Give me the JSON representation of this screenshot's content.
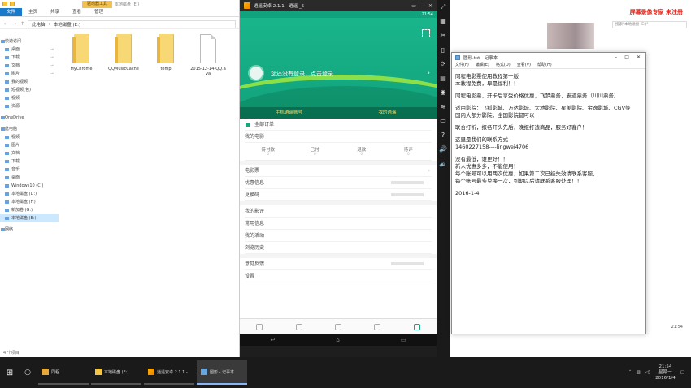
{
  "explorer": {
    "context_tab": "驱动器工具",
    "title": "本地磁盘 (E:)",
    "ribbon_tabs": [
      "文件",
      "主页",
      "共享",
      "查看",
      "管理"
    ],
    "address": [
      "此电脑",
      "本地磁盘 (E:)"
    ],
    "nav": [
      {
        "label": "快速访问",
        "section": true
      },
      {
        "label": "桌面",
        "pinned": true
      },
      {
        "label": "下载",
        "pinned": true
      },
      {
        "label": "文档",
        "pinned": true
      },
      {
        "label": "图片",
        "pinned": true
      },
      {
        "label": "我的视频"
      },
      {
        "label": "短视频(包)"
      },
      {
        "label": "视频"
      },
      {
        "label": "资源"
      },
      {
        "label": "OneDrive",
        "section": true
      },
      {
        "label": "此电脑",
        "section": true
      },
      {
        "label": "视频"
      },
      {
        "label": "图片"
      },
      {
        "label": "文档"
      },
      {
        "label": "下载"
      },
      {
        "label": "音乐"
      },
      {
        "label": "桌面"
      },
      {
        "label": "Windows10 (C:)"
      },
      {
        "label": "本地磁盘 (D:)"
      },
      {
        "label": "本地磁盘 (F:)"
      },
      {
        "label": "新加卷 (G:)"
      },
      {
        "label": "本地磁盘 (E:)",
        "selected": true
      },
      {
        "label": "网络",
        "section": true
      }
    ],
    "files": [
      {
        "name": "MyChrome",
        "kind": "folder"
      },
      {
        "name": "QQMusicCache",
        "kind": "folder"
      },
      {
        "name": "temp",
        "kind": "folder"
      },
      {
        "name": "2015-12-14-QQ.ava",
        "kind": "file"
      }
    ],
    "status": "4 个项目"
  },
  "emulator": {
    "title": "逍遥安卓 2.1.1 - 逍遥 _5",
    "clock": "21:54",
    "login_text": "您还没有登录，点击登录",
    "hero_links": [
      "手机逍遥账号",
      "我的逍遥"
    ],
    "menu_all_orders": "全部订单",
    "my_movies": "我的电影",
    "order_tabs": [
      {
        "label": "待付款",
        "count": "0"
      },
      {
        "label": "已付",
        "count": "0"
      },
      {
        "label": "退款",
        "count": "0"
      },
      {
        "label": "待评",
        "count": "0"
      }
    ],
    "menu_items_a": [
      "电影票",
      "优惠信息",
      "兑换码"
    ],
    "menu_items_b": [
      "我的影评",
      "常用信息",
      "我的活动",
      "浏览历史"
    ],
    "menu_items_c": [
      "意见反馈",
      "设置"
    ]
  },
  "background": {
    "brand": "屏幕录像专家 未注册",
    "search_placeholder": "搜索\"本地磁盘 (E:)\"",
    "clock": "21:54"
  },
  "notepad": {
    "title": "圆形.txt - 记事本",
    "menu": [
      "文件(F)",
      "编辑(E)",
      "格式(O)",
      "查看(V)",
      "帮助(H)"
    ],
    "lines": [
      "同程电影票使用教程第一版",
      "本教程免费，早是福利！！",
      "",
      "同程电影票，开卡后享受价格优惠，飞梦票务，霸道票务（川川票务）",
      "",
      "适用影院：飞狐影城、万达影城、大地影院、星美影院、金逸影城、CGV等",
      "国内大部分影院，全国影院都可以",
      "",
      "联合打折，报名开头先后，晚报打造商品，服务好客户！",
      "",
      "这里是我们的联系方式",
      "1460227158----lingwei4706",
      "",
      "没有最低，谁更好！！",
      "新人优惠多多，不能使用！",
      "每个账号可以用两次优惠，如果第二次已经失效请联系客服，",
      "每个账号最多兑换一次，到期以后请联系客服处理！！",
      "",
      "2016-1-4"
    ]
  },
  "taskbar": {
    "tasks": [
      {
        "label": "同程",
        "kind": "st"
      },
      {
        "label": "本地磁盘 (E:)",
        "kind": "folder"
      },
      {
        "label": "逍遥安卓 2.1.1 -",
        "kind": "emu"
      },
      {
        "label": "圆形 - 记事本",
        "kind": "np",
        "active": true
      }
    ],
    "time": "21:54",
    "day": "星期一",
    "date": "2016/1/4"
  }
}
